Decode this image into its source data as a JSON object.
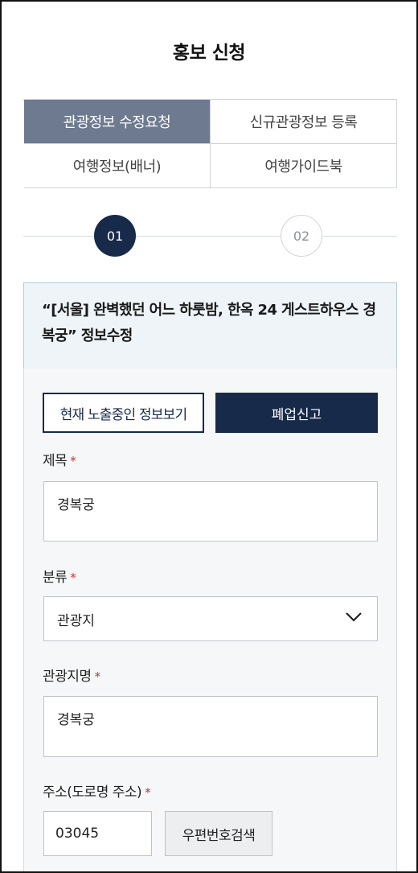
{
  "page": {
    "title": "홍보 신청"
  },
  "tabs": [
    {
      "label": "관광정보 수정요청",
      "active": true
    },
    {
      "label": "신규관광정보 등록",
      "active": false
    },
    {
      "label": "여행정보(배너)",
      "active": false
    },
    {
      "label": "여행가이드북",
      "active": false
    }
  ],
  "steps": [
    {
      "number": "01",
      "current": true
    },
    {
      "number": "02",
      "current": false
    }
  ],
  "notice": {
    "text": "“[서울] 완벽했던 어느 하룻밤, 한옥 24 게스트하우스 경복궁” 정보수정"
  },
  "actions": {
    "view_current": "현재 노출중인 정보보기",
    "closure_report": "폐업신고"
  },
  "form": {
    "title": {
      "label": "제목",
      "required_mark": "*",
      "value": "경복궁"
    },
    "category": {
      "label": "분류",
      "required_mark": "*",
      "value": "관광지"
    },
    "spot_name": {
      "label": "관광지명",
      "required_mark": "*",
      "value": "경복궁"
    },
    "address": {
      "label": "주소(도로명 주소)",
      "required_mark": "*",
      "zipcode": "03045",
      "search_button": "우편번호검색"
    }
  },
  "icons": {
    "category_dropdown": "chevron-down-icon"
  },
  "colors": {
    "navy": "#172a4a",
    "active_tab": "#6d7a8f",
    "required": "#e0262f"
  }
}
